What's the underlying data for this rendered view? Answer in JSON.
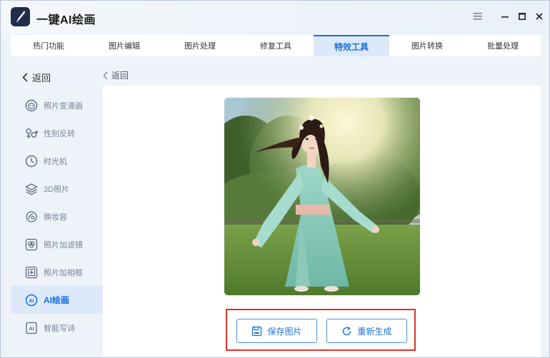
{
  "app": {
    "title": "一键AI绘画"
  },
  "tabs": [
    {
      "label": "热门功能"
    },
    {
      "label": "图片编辑"
    },
    {
      "label": "图片处理"
    },
    {
      "label": "修复工具"
    },
    {
      "label": "特效工具",
      "active": true
    },
    {
      "label": "图片转换"
    },
    {
      "label": "批量处理"
    }
  ],
  "sidebar": {
    "back_label": "返回",
    "items": [
      {
        "label": "照片变漫画",
        "icon": "face-icon"
      },
      {
        "label": "性别反转",
        "icon": "gender-icon"
      },
      {
        "label": "时光机",
        "icon": "clock-icon"
      },
      {
        "label": "3D照片",
        "icon": "layers-icon"
      },
      {
        "label": "换妆容",
        "icon": "makeup-icon"
      },
      {
        "label": "照片加滤镜",
        "icon": "filter-icon"
      },
      {
        "label": "照片加相框",
        "icon": "frame-icon"
      },
      {
        "label": "AI绘画",
        "icon": "ai-icon",
        "active": true
      },
      {
        "label": "智能写诗",
        "icon": "ai-doc-icon"
      }
    ]
  },
  "content": {
    "back_label": "返回",
    "save_label": "保存图片",
    "regen_label": "重新生成"
  },
  "colors": {
    "accent": "#1a6fdb",
    "active_bg": "#dde9fb",
    "highlight": "#d9342b"
  }
}
